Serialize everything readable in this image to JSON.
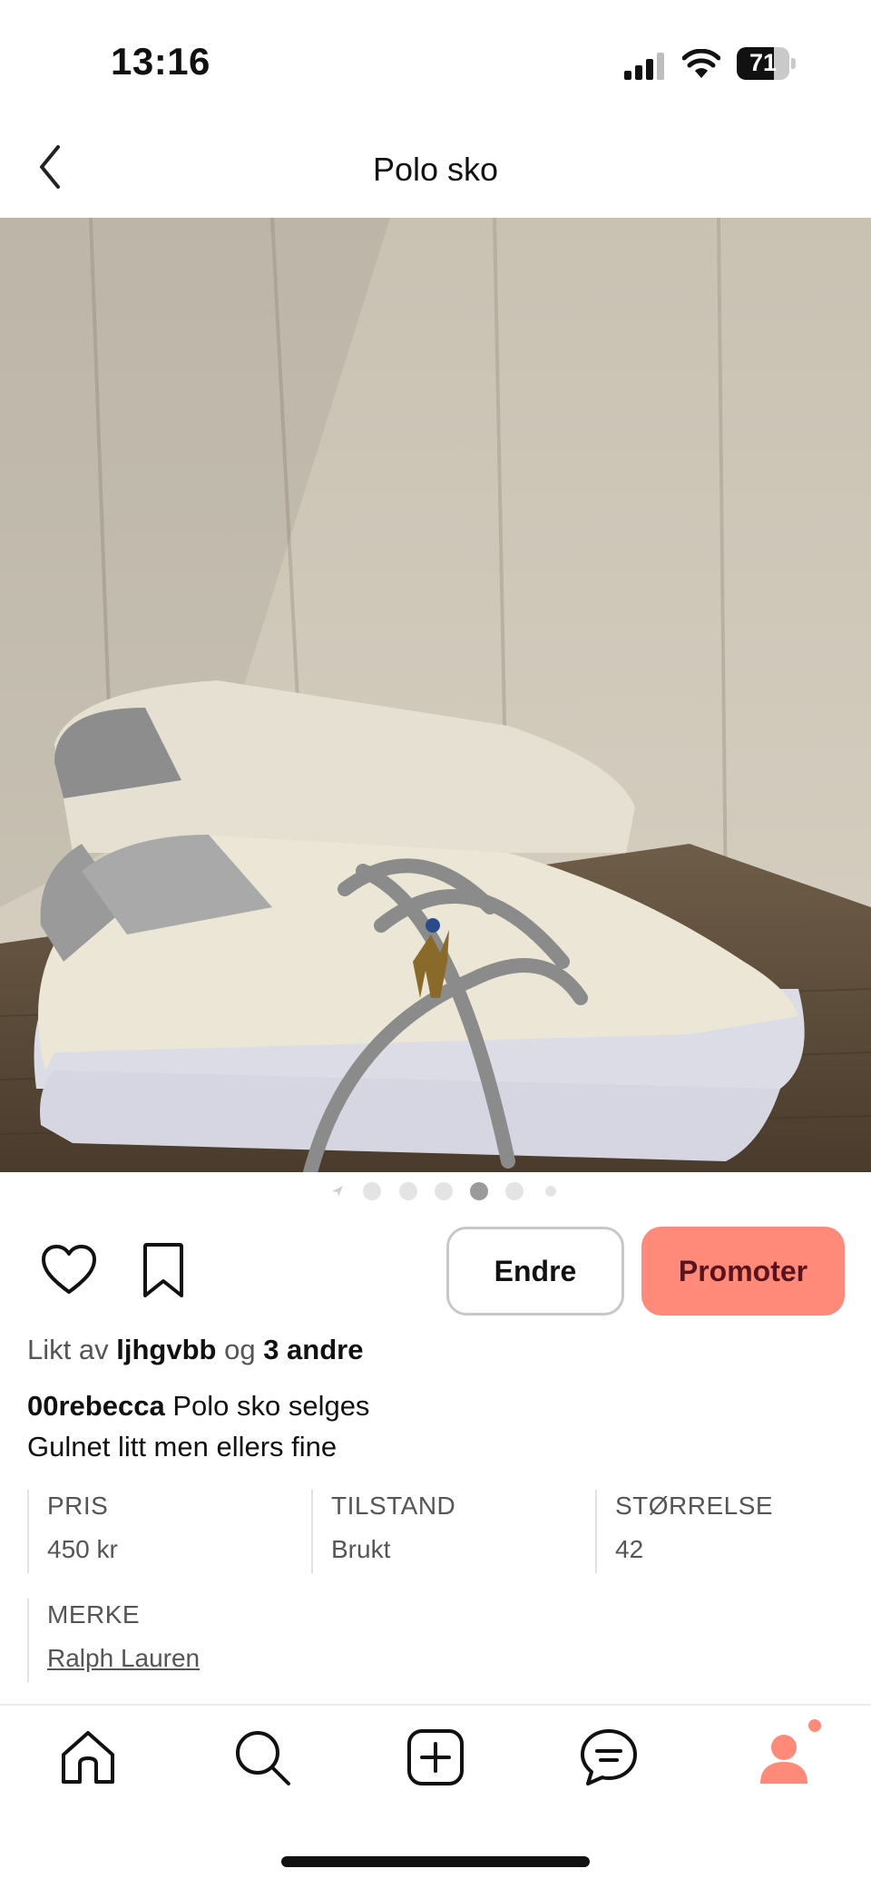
{
  "status_bar": {
    "time": "13:16",
    "battery": "71",
    "battery_level": 0.71
  },
  "header": {
    "title": "Polo sko"
  },
  "gallery": {
    "total_images": 6,
    "active_index": 3
  },
  "actions": {
    "edit_label": "Endre",
    "promote_label": "Promoter"
  },
  "likes": {
    "prefix": "Likt av",
    "user": "ljhgvbb",
    "joiner": "og",
    "others": "3 andre"
  },
  "post": {
    "username": "00rebecca",
    "title": "Polo sko selges",
    "description": "Gulnet litt men ellers fine"
  },
  "attributes": [
    {
      "label": "PRIS",
      "value": "450 kr"
    },
    {
      "label": "TILSTAND",
      "value": "Brukt"
    },
    {
      "label": "STØRRELSE",
      "value": "42"
    },
    {
      "label": "MERKE",
      "value": "Ralph Lauren"
    }
  ],
  "tabbar": {
    "items": [
      "home-icon",
      "search-icon",
      "add-icon",
      "messages-icon",
      "profile-icon"
    ],
    "profile_notification": true
  },
  "colors": {
    "accent": "#ff8a7a",
    "promote_text": "#5a1420"
  }
}
